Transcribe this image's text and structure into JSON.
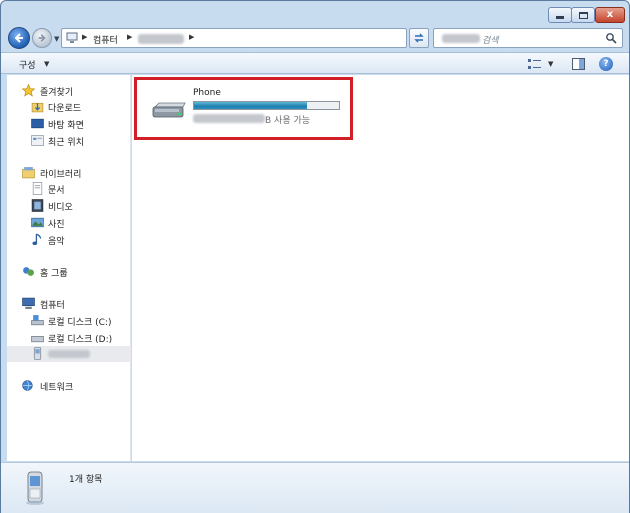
{
  "window": {
    "minimize_label": "",
    "maximize_label": "",
    "close_label": "x"
  },
  "address": {
    "crumbs": [
      "컴퓨터"
    ],
    "search_placeholder": "검색"
  },
  "toolbar": {
    "organize_label": "구성"
  },
  "sidebar": {
    "favorites": {
      "header": "즐겨찾기",
      "items": [
        {
          "label": "다운로드",
          "icon": "download-folder-icon"
        },
        {
          "label": "바탕 화면",
          "icon": "desktop-icon"
        },
        {
          "label": "최근 위치",
          "icon": "recent-places-icon"
        }
      ]
    },
    "libraries": {
      "header": "라이브러리",
      "items": [
        {
          "label": "문서",
          "icon": "documents-icon"
        },
        {
          "label": "비디오",
          "icon": "video-icon"
        },
        {
          "label": "사진",
          "icon": "pictures-icon"
        },
        {
          "label": "음악",
          "icon": "music-icon"
        }
      ]
    },
    "homegroup": {
      "header": "홈 그룹"
    },
    "computer": {
      "header": "컴퓨터",
      "items": [
        {
          "label": "로컬 디스크 (C:)",
          "icon": "local-disk-icon"
        },
        {
          "label": "로컬 디스크 (D:)",
          "icon": "local-disk-icon"
        }
      ]
    },
    "network": {
      "header": "네트워크"
    }
  },
  "content": {
    "device_name": "Phone",
    "free_space_suffix": "B 사용 가능",
    "capacity_used_fraction": 0.78
  },
  "status": {
    "item_count": "1개 항목"
  },
  "colors": {
    "highlight_border": "#d11f27",
    "capacity_fill": "#1f7fae",
    "chrome": "#c8dcef"
  }
}
